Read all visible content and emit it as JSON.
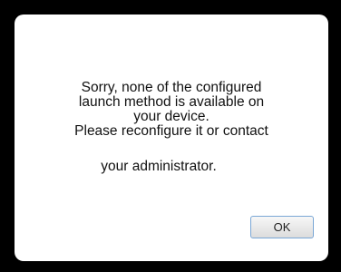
{
  "dialog": {
    "message_lines": [
      "Sorry, none of the configured",
      "launch method is available on",
      "your device.",
      "Please reconfigure it or contact",
      "your administrator."
    ],
    "ok_label": "OK"
  }
}
